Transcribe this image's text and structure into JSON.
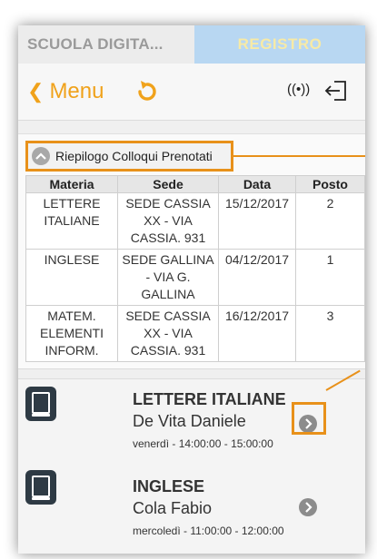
{
  "tabs": {
    "left_label": "SCUOLA DIGITA...",
    "right_label": "REGISTRO"
  },
  "header": {
    "back_label": "Menu",
    "icons": [
      "chevron-left-icon",
      "refresh-icon",
      "radio-signal-icon",
      "logout-icon"
    ],
    "signal_glyph": "((•))"
  },
  "summary": {
    "label": "Riepilogo Colloqui Prenotati",
    "icon": "chevron-up-circle-icon"
  },
  "table": {
    "headers": [
      "Materia",
      "Sede",
      "Data",
      "Posto"
    ],
    "rows": [
      {
        "materia": "LETTERE ITALIANE",
        "sede": "SEDE CASSIA XX - VIA CASSIA. 931",
        "data": "15/12/2017",
        "posto": "2"
      },
      {
        "materia": "INGLESE",
        "sede": "SEDE GALLINA - VIA G. GALLINA",
        "data": "04/12/2017",
        "posto": "1"
      },
      {
        "materia": "MATEM. ELEMENTI INFORM.",
        "sede": "SEDE CASSIA XX - VIA CASSIA. 931",
        "data": "16/12/2017",
        "posto": "3"
      }
    ]
  },
  "cards": [
    {
      "subject": "LETTERE ITALIANE",
      "teacher": "De Vita Daniele",
      "time": "venerdì - 14:00:00 - 15:00:00"
    },
    {
      "subject": "INGLESE",
      "teacher": "Cola Fabio",
      "time": "mercoledì - 11:00:00 - 12:00:00"
    }
  ],
  "colors": {
    "accent": "#f0a21b",
    "highlight": "#e8911a",
    "tab_active": "#b8d7f2",
    "icon_dark": "#2e3a44"
  }
}
